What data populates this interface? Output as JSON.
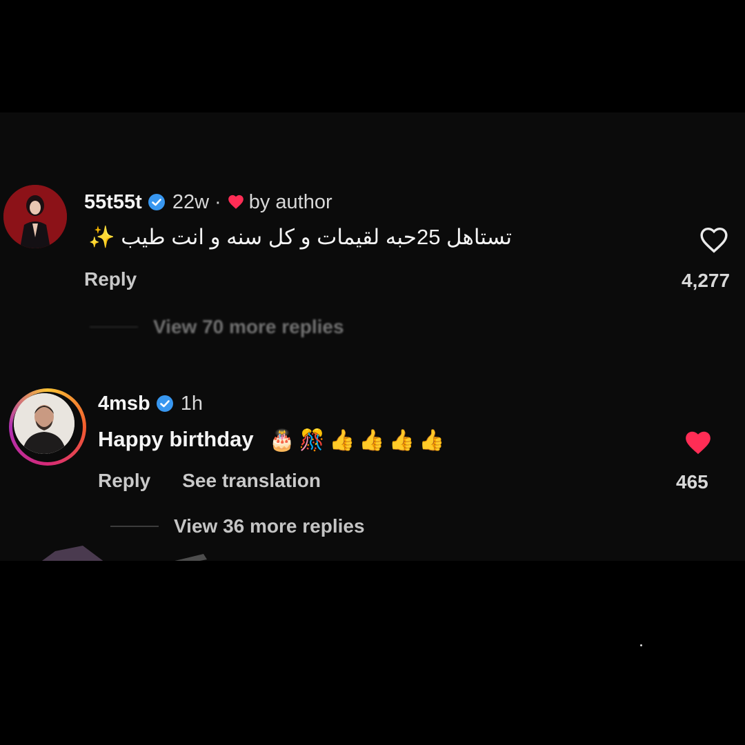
{
  "comments": [
    {
      "username": "55t55t",
      "time": "22w",
      "separator": "·",
      "author_badge": "by author",
      "text": "تستاهل 25حبه لقيمات و كل سنه و انت طيب ✨",
      "reply_label": "Reply",
      "likes": "4,277",
      "liked": false,
      "view_replies": "View 70 more replies"
    },
    {
      "username": "4msb",
      "time": "1h",
      "text": "Happy birthday",
      "emojis": [
        "🎂",
        "🎊",
        "👍",
        "👍",
        "👍",
        "👍"
      ],
      "reply_label": "Reply",
      "translate_label": "See translation",
      "likes": "465",
      "liked": true,
      "view_replies": "View 36 more replies"
    }
  ],
  "colors": {
    "background": "#000000",
    "panel": "#0b0b0b",
    "verified": "#3897f0",
    "like_red": "#ff2d55"
  },
  "icons": {
    "verified": "verified-badge-icon",
    "author_heart": "heart-icon",
    "like_empty": "heart-outline-icon",
    "like_filled": "heart-filled-icon"
  }
}
